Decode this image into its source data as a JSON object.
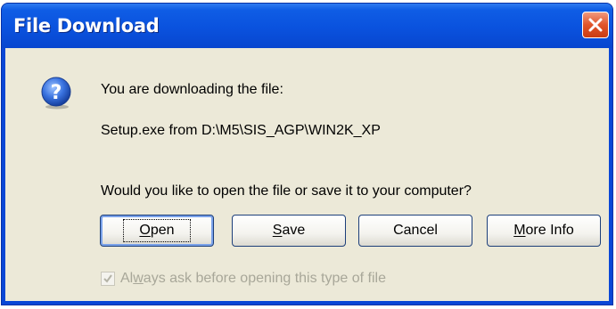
{
  "window": {
    "title": "File Download",
    "close_label": "Close"
  },
  "icons": {
    "question": "question-mark-icon",
    "close": "close-icon",
    "check": "checkmark-icon"
  },
  "colors": {
    "titlebar": "#0a52de",
    "close_button": "#e0542a",
    "client": "#ece9d8",
    "disabled_text": "#a8a799"
  },
  "dialog": {
    "message_line1": "You are downloading the file:",
    "file_info": "Setup.exe from D:\\M5\\SIS_AGP\\WIN2K_XP",
    "question": "Would you like to open the file or save it to your computer?"
  },
  "buttons": {
    "open": {
      "mnemonic": "O",
      "rest": "pen"
    },
    "save": {
      "mnemonic": "S",
      "rest": "ave"
    },
    "cancel": "Cancel",
    "more_info": {
      "mnemonic": "M",
      "rest": "ore Info"
    }
  },
  "checkbox": {
    "label_pre": "Al",
    "label_mnemonic": "w",
    "label_post": "ays ask before opening this type of file",
    "checked": true,
    "enabled": false
  }
}
